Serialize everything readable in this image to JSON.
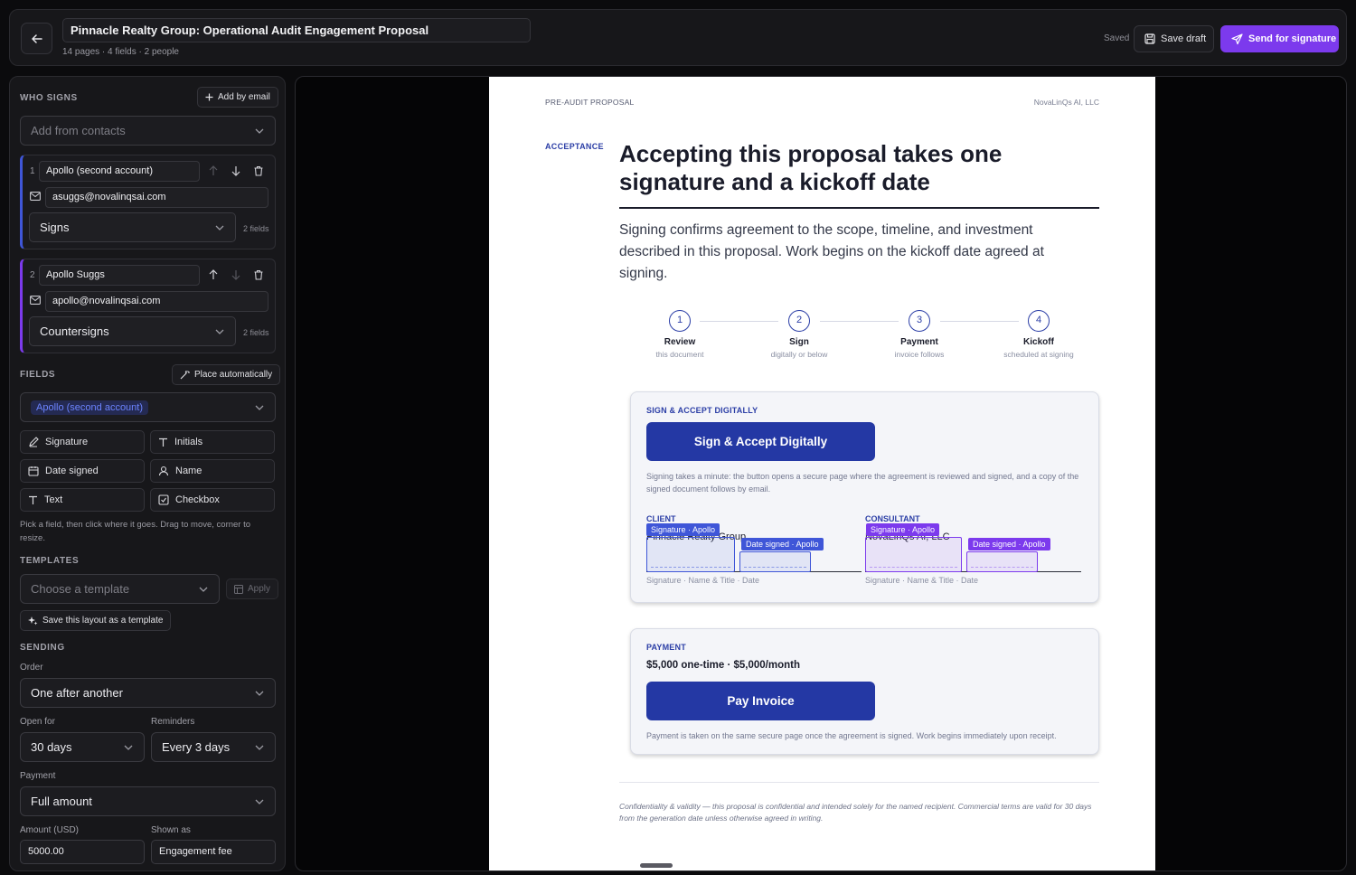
{
  "header": {
    "title": "Pinnacle Realty Group: Operational Audit Engagement Proposal",
    "meta": "14 pages · 4 fields · 2 people",
    "saved": "Saved",
    "save_draft": "Save draft",
    "send": "Send for signature"
  },
  "sidebar": {
    "who_signs": {
      "label": "WHO SIGNS",
      "add_by_email": "Add by email",
      "contacts_placeholder": "Add from contacts"
    },
    "signers": [
      {
        "num": "1",
        "name": "Apollo (second account)",
        "email": "asuggs@novalinqsai.com",
        "role": "Signs",
        "fields": "2 fields"
      },
      {
        "num": "2",
        "name": "Apollo Suggs",
        "email": "apollo@novalinqsai.com",
        "role": "Countersigns",
        "fields": "2 fields"
      }
    ],
    "fields": {
      "label": "FIELDS",
      "place_auto": "Place automatically",
      "assignee": "Apollo (second account)",
      "items": [
        "Signature",
        "Initials",
        "Date signed",
        "Name",
        "Text",
        "Checkbox"
      ],
      "hint": "Pick a field, then click where it goes. Drag to move, corner to resize."
    },
    "templates": {
      "label": "TEMPLATES",
      "placeholder": "Choose a template",
      "apply": "Apply",
      "save_layout": "Save this layout as a template"
    },
    "sending": {
      "label": "SENDING",
      "order_label": "Order",
      "order": "One after another",
      "open_for_label": "Open for",
      "open_for": "30 days",
      "reminders_label": "Reminders",
      "reminders": "Every 3 days",
      "payment_label": "Payment",
      "payment": "Full amount",
      "amount_label": "Amount (USD)",
      "amount": "5000.00",
      "shown_as_label": "Shown as",
      "shown_as": "Engagement fee"
    }
  },
  "document": {
    "header_left": "PRE-AUDIT PROPOSAL",
    "header_right": "NovaLinQs AI, LLC",
    "section_tag": "ACCEPTANCE",
    "heading": "Accepting this proposal takes one signature and a kickoff date",
    "lead": "Signing confirms agreement to the scope, timeline, and investment described in this proposal. Work begins on the kickoff date agreed at signing.",
    "steps": [
      {
        "n": "1",
        "title": "Review",
        "sub": "this document"
      },
      {
        "n": "2",
        "title": "Sign",
        "sub": "digitally or below"
      },
      {
        "n": "3",
        "title": "Payment",
        "sub": "invoice follows"
      },
      {
        "n": "4",
        "title": "Kickoff",
        "sub": "scheduled at signing"
      }
    ],
    "sign_box": {
      "title": "SIGN & ACCEPT DIGITALLY",
      "button": "Sign & Accept Digitally",
      "desc": "Signing takes a minute: the button opens a secure page where the agreement is reviewed and signed, and a copy of the signed document follows by email.",
      "client_label": "CLIENT",
      "client_name": "Pinnacle Realty Group",
      "consultant_label": "CONSULTANT",
      "consultant_name": "NovaLinQs AI, LLC",
      "caption": "Signature · Name & Title · Date",
      "tag_signature": "Signature · Apollo",
      "tag_date": "Date signed · Apollo"
    },
    "pay_box": {
      "title": "PAYMENT",
      "amount": "$5,000 one-time · $5,000/month",
      "button": "Pay Invoice",
      "desc": "Payment is taken on the same secure page once the agreement is signed. Work begins immediately upon receipt."
    },
    "footer": "Confidentiality & validity — this proposal is confidential and intended solely for the named recipient. Commercial terms are valid for 30 days from the generation date unless otherwise agreed in writing."
  },
  "colors": {
    "accent": "#7c3aed",
    "doc_blue": "#2438a4",
    "signer_blue": "#3f56d8",
    "signer_purple": "#7c3aed"
  }
}
